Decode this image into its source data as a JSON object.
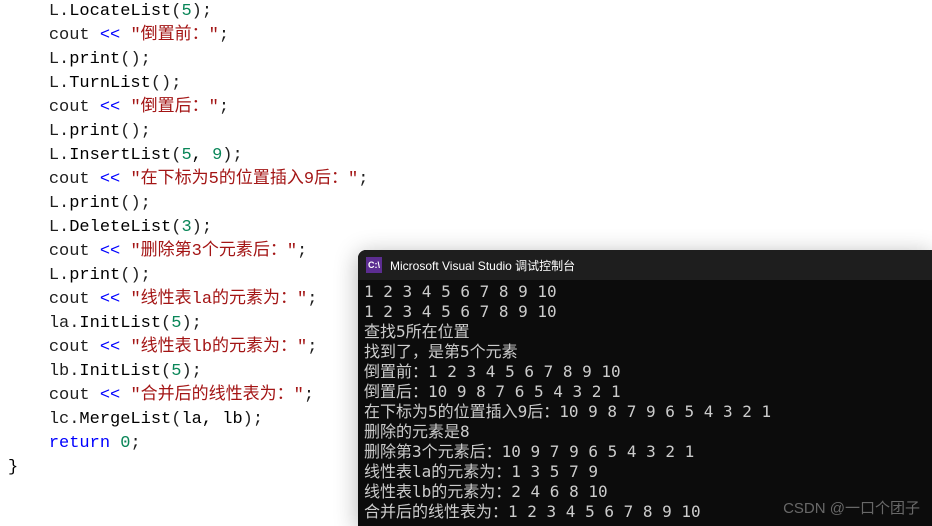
{
  "code": {
    "lines": [
      {
        "obj": "L",
        "method": "LocateList",
        "args": "5",
        "term": ";"
      },
      {
        "cout": true,
        "str": "\"倒置前：\"",
        "term": ";"
      },
      {
        "obj": "L",
        "method": "print",
        "args": "",
        "term": ";"
      },
      {
        "obj": "L",
        "method": "TurnList",
        "args": "",
        "term": ";"
      },
      {
        "cout": true,
        "str": "\"倒置后：\"",
        "term": ";"
      },
      {
        "obj": "L",
        "method": "print",
        "args": "",
        "term": ";"
      },
      {
        "obj": "L",
        "method": "InsertList",
        "args": "5, 9",
        "term": ";"
      },
      {
        "cout": true,
        "str": "\"在下标为5的位置插入9后：\"",
        "term": ";"
      },
      {
        "obj": "L",
        "method": "print",
        "args": "",
        "term": ";"
      },
      {
        "obj": "L",
        "method": "DeleteList",
        "args": "3",
        "term": ";"
      },
      {
        "cout": true,
        "str": "\"删除第3个元素后：\"",
        "term": ";"
      },
      {
        "obj": "L",
        "method": "print",
        "args": "",
        "term": ";"
      },
      {
        "cout": true,
        "str": "\"线性表la的元素为：\"",
        "term": ";"
      },
      {
        "obj": "la",
        "method": "InitList",
        "args": "5",
        "term": ";"
      },
      {
        "cout": true,
        "str": "\"线性表lb的元素为：\"",
        "term": ";"
      },
      {
        "obj": "lb",
        "method": "InitList",
        "args": "5",
        "term": ";"
      },
      {
        "cout": true,
        "str": "\"合并后的线性表为：\"",
        "term": ";"
      },
      {
        "obj": "lc",
        "method": "MergeList",
        "args": "la, lb",
        "term": ";"
      },
      {
        "ret": true,
        "val": "0",
        "term": ";"
      }
    ],
    "closing_brace": "}"
  },
  "console": {
    "icon_text": "C:\\",
    "title": "Microsoft Visual Studio 调试控制台",
    "output": [
      "1 2 3 4 5 6 7 8 9 10",
      "1 2 3 4 5 6 7 8 9 10",
      "查找5所在位置",
      "找到了，是第5个元素",
      "倒置前：1 2 3 4 5 6 7 8 9 10",
      "倒置后：10 9 8 7 6 5 4 3 2 1",
      "在下标为5的位置插入9后：10 9 8 7 9 6 5 4 3 2 1",
      "删除的元素是8",
      "删除第3个元素后：10 9 7 9 6 5 4 3 2 1",
      "线性表la的元素为：1 3 5 7 9",
      "线性表lb的元素为：2 4 6 8 10",
      "合并后的线性表为：1 2 3 4 5 6 7 8 9 10"
    ]
  },
  "watermark": "CSDN @一口个团子"
}
